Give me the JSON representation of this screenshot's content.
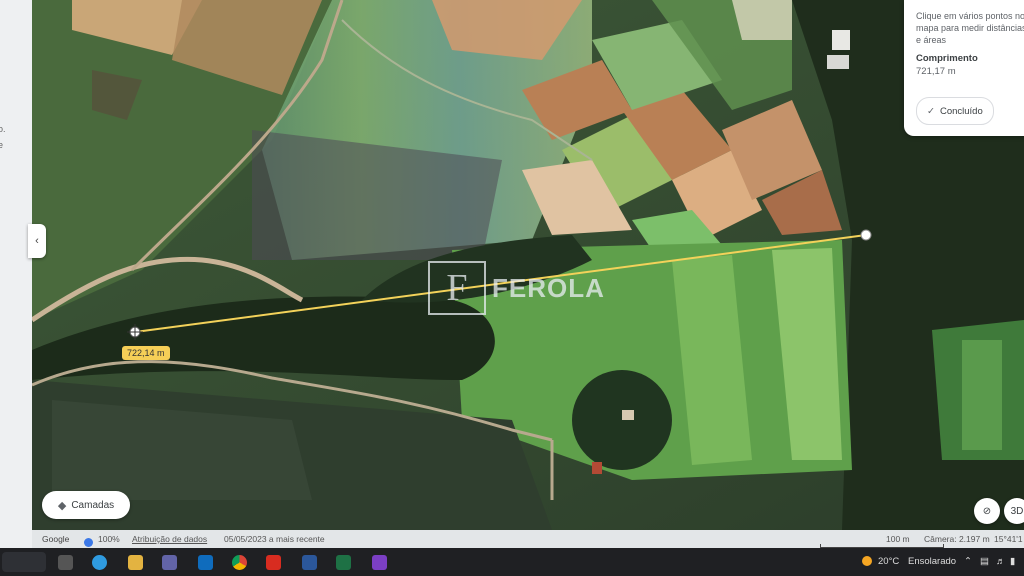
{
  "measure_panel": {
    "hint": "Clique em vários pontos no mapa para medir distâncias e áreas",
    "title": "Comprimento",
    "value": "721,17 m",
    "done_label": "Concluído"
  },
  "distance_label": "722,14 m",
  "watermark": {
    "letter": "F",
    "text": "FEROLA"
  },
  "layers_button": "Camadas",
  "corner_buttons": {
    "tilt": "",
    "view_3d": "3D"
  },
  "footer": {
    "brand": "Google",
    "zoom": "100%",
    "attribution": "Atribuição de dados",
    "imagery_date": "05/05/2023 a mais recente",
    "scale": "100 m",
    "camera": "Câmera: 2.197 m",
    "coords": "15°41'1"
  },
  "taskbar": {
    "temperature": "20°C",
    "weather": "Ensolarado"
  },
  "left_fragments": [
    "o.",
    "e"
  ],
  "colors": {
    "measure_line": "#f3d25a",
    "label_bg": "#f6cf57"
  }
}
